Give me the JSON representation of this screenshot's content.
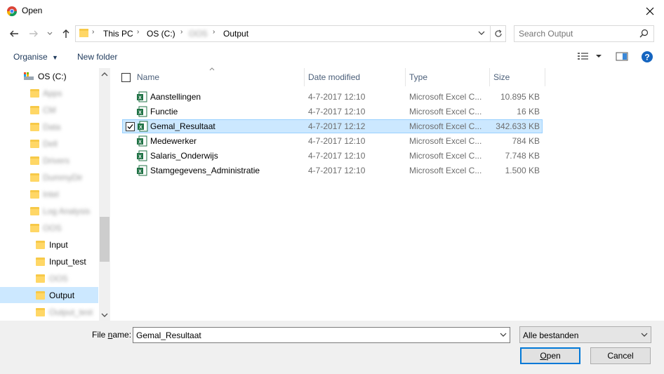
{
  "window": {
    "title": "Open",
    "accent": "#0078d7"
  },
  "address": {
    "crumbs": [
      "This PC",
      "OS (C:)",
      "OOS",
      "Output"
    ],
    "search_placeholder": "Search Output"
  },
  "toolbar": {
    "organise_label": "Organise",
    "new_folder_label": "New folder"
  },
  "nav": {
    "drive_label": "OS (C:)",
    "items": [
      {
        "label": "Apps",
        "blurred": true
      },
      {
        "label": "CM",
        "blurred": true
      },
      {
        "label": "Data",
        "blurred": true
      },
      {
        "label": "Dell",
        "blurred": true
      },
      {
        "label": "Drivers",
        "blurred": true
      },
      {
        "label": "DummyDir",
        "blurred": true
      },
      {
        "label": "Intel",
        "blurred": true
      },
      {
        "label": "Log Analysis",
        "blurred": true
      },
      {
        "label": "OOS",
        "blurred": true
      },
      {
        "label": "Input",
        "blurred": false
      },
      {
        "label": "Input_test",
        "blurred": false
      },
      {
        "label": "OOS",
        "blurred": true
      },
      {
        "label": "Output",
        "blurred": false
      },
      {
        "label": "Output_test",
        "blurred": true
      }
    ],
    "selected_label": "Output"
  },
  "filelist": {
    "columns": {
      "name": "Name",
      "date": "Date modified",
      "type": "Type",
      "size": "Size"
    },
    "rows": [
      {
        "name": "Aanstellingen",
        "date": "4-7-2017 12:10",
        "type": "Microsoft Excel C...",
        "size": "10.895 KB"
      },
      {
        "name": "Functie",
        "date": "4-7-2017 12:10",
        "type": "Microsoft Excel C...",
        "size": "16 KB"
      },
      {
        "name": "Gemal_Resultaat",
        "date": "4-7-2017 12:12",
        "type": "Microsoft Excel C...",
        "size": "342.633 KB"
      },
      {
        "name": "Medewerker",
        "date": "4-7-2017 12:10",
        "type": "Microsoft Excel C...",
        "size": "784 KB"
      },
      {
        "name": "Salaris_Onderwijs",
        "date": "4-7-2017 12:10",
        "type": "Microsoft Excel C...",
        "size": "7.748 KB"
      },
      {
        "name": "Stamgegevens_Administratie",
        "date": "4-7-2017 12:10",
        "type": "Microsoft Excel C...",
        "size": "1.500 KB"
      }
    ],
    "selected_row": "Gemal_Resultaat"
  },
  "bottom": {
    "filename_label_pre": "File ",
    "filename_label_mn": "n",
    "filename_label_post": "ame:",
    "filename_value": "Gemal_Resultaat",
    "filter_value": "Alle bestanden",
    "open_label_mn": "O",
    "open_label_rest": "pen",
    "cancel_label": "Cancel"
  }
}
